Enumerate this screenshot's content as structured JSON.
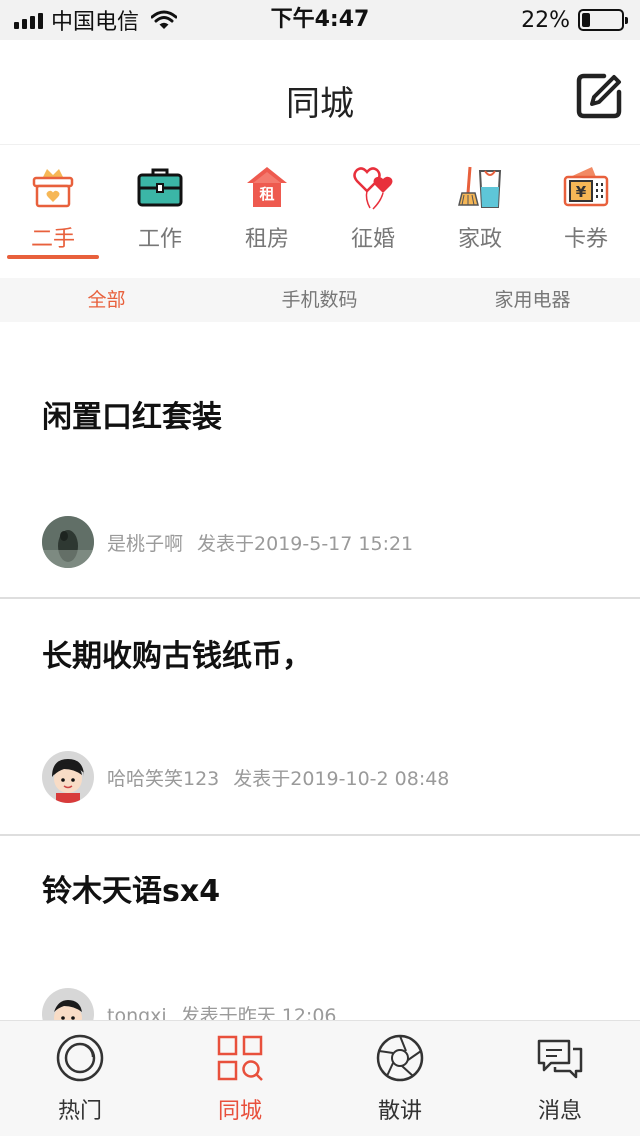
{
  "status_bar": {
    "carrier": "中国电信",
    "time": "下午4:47",
    "battery_percent": "22%",
    "battery_level": 0.22
  },
  "nav": {
    "title": "同城",
    "edit_icon": "edit-icon"
  },
  "categories": [
    {
      "label": "二手",
      "icon": "secondhand-basket-icon",
      "active": true
    },
    {
      "label": "工作",
      "icon": "briefcase-icon",
      "active": false
    },
    {
      "label": "租房",
      "icon": "house-icon",
      "active": false
    },
    {
      "label": "征婚",
      "icon": "hearts-balloon-icon",
      "active": false
    },
    {
      "label": "家政",
      "icon": "broom-bucket-icon",
      "active": false
    },
    {
      "label": "卡券",
      "icon": "ticket-icon",
      "active": false
    }
  ],
  "category_badges": {
    "house": "租",
    "ticket": "¥"
  },
  "sub_tabs": [
    {
      "label": "全部",
      "active": true
    },
    {
      "label": "手机数码",
      "active": false
    },
    {
      "label": "家用电器",
      "active": false
    }
  ],
  "posts": [
    {
      "title": "闲置口红套装",
      "author": "是桃子啊",
      "posted": "发表于2019-5-17 15:21"
    },
    {
      "title": "长期收购古钱纸币，",
      "author": "哈哈笑笑123",
      "posted": "发表于2019-10-2 08:48"
    },
    {
      "title": "铃木天语sx4",
      "author": "tongxi",
      "posted": "发表于昨天 12:06"
    }
  ],
  "tabs": [
    {
      "label": "热门",
      "icon": "circle-lens-icon",
      "active": false
    },
    {
      "label": "同城",
      "icon": "grid-search-icon",
      "active": true
    },
    {
      "label": "散讲",
      "icon": "aperture-icon",
      "active": false
    },
    {
      "label": "消息",
      "icon": "chat-bubbles-icon",
      "active": false
    }
  ],
  "colors": {
    "accent": "#e8603c",
    "tab_active": "#e8503c",
    "muted_text": "#9a9a9a"
  }
}
